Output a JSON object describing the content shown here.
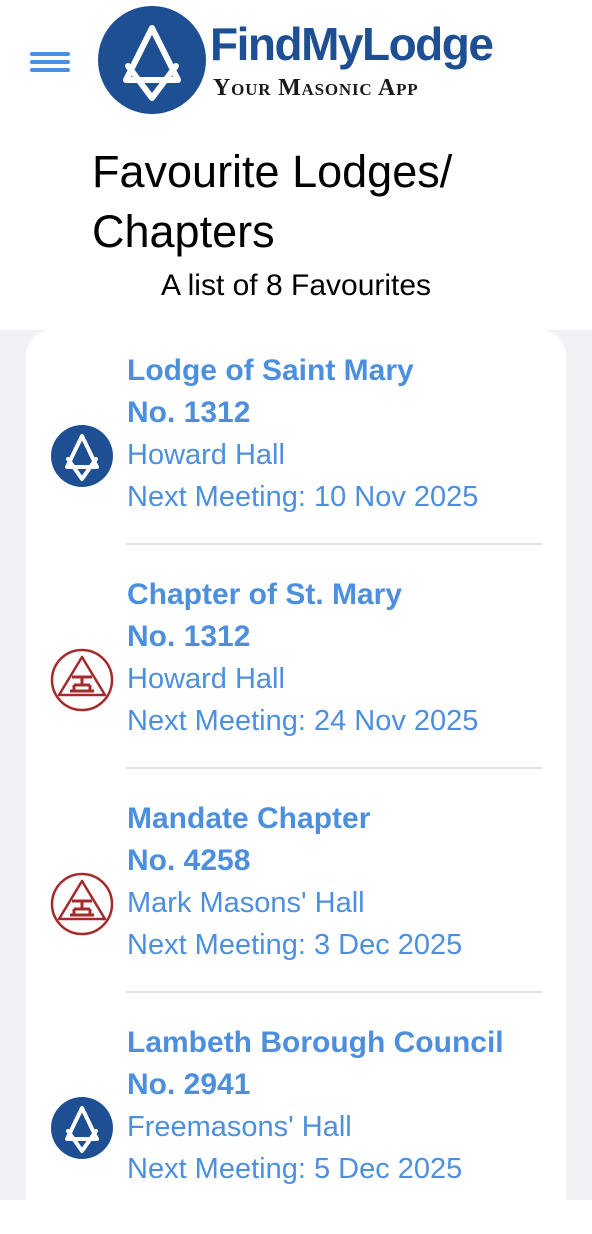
{
  "header": {
    "brand_name": "FindMyLodge",
    "brand_tagline": "Your Masonic App",
    "menu_icon": "hamburger-menu-icon",
    "brand_color": "#1f4f93"
  },
  "page": {
    "title": "Favourite Lodges/ Chapters",
    "subtitle": "A list of 8 Favourites"
  },
  "favourites": [
    {
      "name": "Lodge of Saint Mary",
      "number": "No. 1312",
      "venue": "Howard Hall",
      "next_meeting": "Next Meeting:  10 Nov 2025",
      "icon": "square-compasses-icon"
    },
    {
      "name": "Chapter of St. Mary",
      "number": "No. 1312",
      "venue": "Howard Hall",
      "next_meeting": "Next Meeting:  24 Nov 2025",
      "icon": "triple-tau-icon"
    },
    {
      "name": "Mandate Chapter",
      "number": "No. 4258",
      "venue": "Mark Masons' Hall",
      "next_meeting": "Next Meeting:  3 Dec 2025",
      "icon": "triple-tau-icon"
    },
    {
      "name": "Lambeth Borough Council",
      "number": "No. 2941",
      "venue": "Freemasons' Hall",
      "next_meeting": "Next Meeting:  5 Dec 2025",
      "icon": "square-compasses-icon"
    }
  ],
  "colors": {
    "link_blue": "#4d8fdf",
    "lodge_icon_blue": "#1f4f93",
    "chapter_icon_red": "#a62a2a",
    "list_background": "#f2f2f6"
  }
}
